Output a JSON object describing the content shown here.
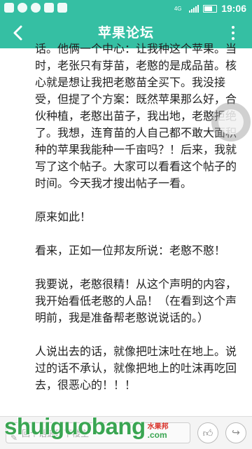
{
  "status_bar": {
    "network": "4G",
    "time": "19:06"
  },
  "header": {
    "title": "苹果论坛",
    "back_icon": "chevron-left-icon",
    "menu_icon": "more-vertical-icon"
  },
  "post": {
    "paragraphs": [
      "话。他俩一个中心：让我种这个苹果。当时，老张只有芽苗，老憨的是成品苗。核心就是想让我把老憨苗全买下。我没接受，但提了个方案：既然苹果那么好，合伙种植，老憨出苗子，我出地，老憨拒绝了。我想，连育苗的人自己都不敢大面积种的苹果我能种一千亩吗？！后来，我就写了这个帖子。大家可以看看这个帖子的时间。今天我才搜出帖子一看。",
      "原来如此！",
      "看来，正如一位邦友所说：老憨不憨！",
      "我要说，老憨很精！从这个声明的内容，我开始看低老憨的人品！（在看到这个声明前，我是准备帮老憨说说话的。）",
      "人说出去的话，就像把吐沫吐在地上。说过的话不承认，就像把地上的吐沫再吃回去，很恶心的！！！"
    ]
  },
  "bottom_bar": {
    "reply_placeholder": "回个话鼓励下楼主",
    "like_icon": "thumbs-up-icon",
    "share_icon": "share-icon"
  },
  "watermark": {
    "main": "shuiguobang",
    "cn": "水果邦",
    "sub": ".com"
  },
  "colors": {
    "accent": "#35bfa3",
    "watermark_green": "#3aa552",
    "watermark_red": "#d9322a"
  }
}
